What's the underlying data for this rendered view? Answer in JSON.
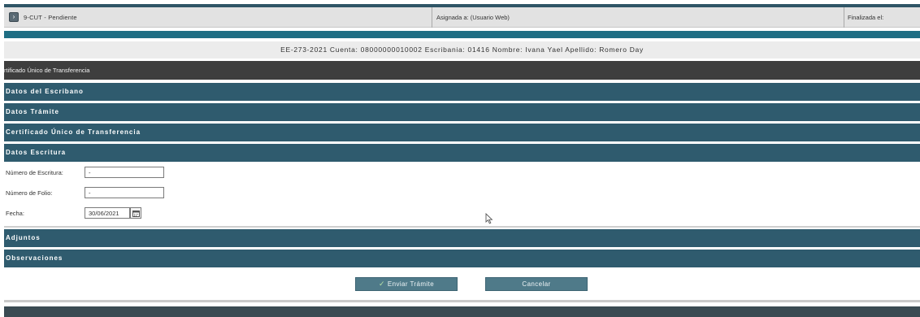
{
  "task": {
    "title": "9-CUT - Pendiente",
    "assigned": "Asignada a: (Usuario Web)",
    "finished": "Finalizada el:"
  },
  "info": "EE-273-2021 Cuenta: 08000000010002 Escribania: 01416 Nombre: Ivana Yael Apellido: Romero Day",
  "form_title": "rtificado Único de Transferencia",
  "sections": {
    "escribano": "Datos del Escribano",
    "tramite": "Datos Trámite",
    "certificado": "Certificado Único de Transferencia",
    "escritura": "Datos Escritura",
    "adjuntos": "Adjuntos",
    "observaciones": "Observaciones"
  },
  "fields": {
    "numero_escritura": {
      "label": "Número de Escritura:",
      "value": "-"
    },
    "numero_folio": {
      "label": "Número de Folio:",
      "value": "-"
    },
    "fecha": {
      "label": "Fecha:",
      "value": "30/06/2021"
    }
  },
  "buttons": {
    "send": "Enviar Trámite",
    "cancel": "Cancelar"
  },
  "colors": {
    "section_bg": "#2f5b6e",
    "header_bg": "#3e3e3e",
    "accent_teal": "#1f6e84",
    "button_bg": "#4f7a89"
  },
  "icons": {
    "expand": "chevron-right-icon",
    "calendar": "calendar-icon",
    "check": "check-icon",
    "cursor": "mouse-pointer-icon"
  }
}
